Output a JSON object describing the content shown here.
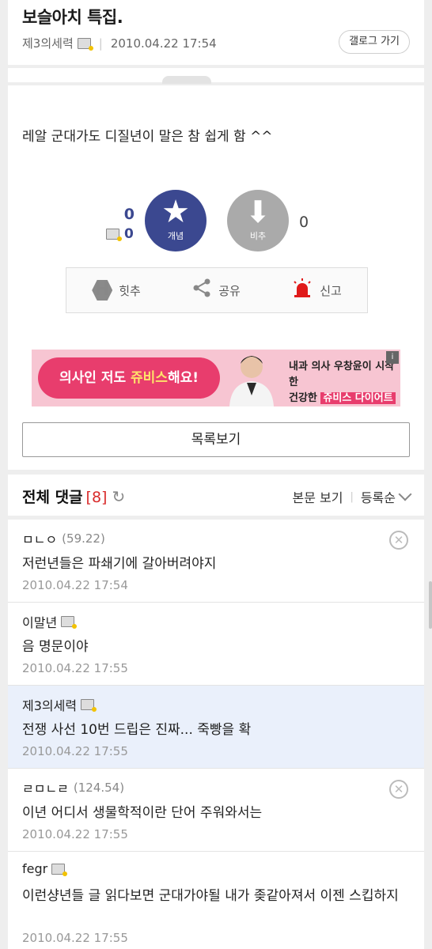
{
  "post": {
    "title": "보슬아치 특집.",
    "author": "제3의세력",
    "date": "2010.04.22 17:54",
    "gallog_button": "갤로그 가기",
    "content": "레알 군대가도 디질년이 말은 참 쉽게 함 ^^"
  },
  "recommend": {
    "up_count": "0",
    "fixed_count": "0",
    "up_label": "개념",
    "down_label": "비추",
    "down_count": "0"
  },
  "actions": {
    "hit_label": "힛추",
    "share_label": "공유",
    "report_label": "신고"
  },
  "banner": {
    "left_prefix": "의사인 저도 ",
    "left_highlight": "쥬비스",
    "left_suffix": "해요!",
    "right_line1": "내과 의사 우창윤이 시작한",
    "right_line2_prefix": "건강한 ",
    "right_line2_highlight": "쥬비스 다이어트",
    "ad_mark": "i"
  },
  "list_button": "목록보기",
  "comments_header": {
    "title": "전체 댓글",
    "count": "[8]",
    "view_body": "본문 보기",
    "sort": "등록순"
  },
  "comments": [
    {
      "name": "ㅁㄴㅇ",
      "ip": "(59.22)",
      "text": "저런년들은 파쇄기에 갈아버려야지",
      "date": "2010.04.22 17:54"
    },
    {
      "name": "이말년",
      "ip": "",
      "text": "음 명문이야",
      "date": "2010.04.22 17:55"
    },
    {
      "name": "제3의세력",
      "ip": "",
      "text": "전쟁 사선 10번 드립은 진짜... 죽빵을 확",
      "date": "2010.04.22 17:55"
    },
    {
      "name": "ㄹㅁㄴㄹ",
      "ip": "(124.54)",
      "text": "이년 어디서 생물학적이란 단어 주워와서는",
      "date": "2010.04.22 17:55"
    },
    {
      "name": "fegr",
      "ip": "",
      "text": "이런샹년들 글 읽다보면 군대가야될 내가 좆같아져서 이젠 스킵하지",
      "date": "2010.04.22 17:55"
    }
  ],
  "colors": {
    "accent": "#3b4890",
    "count_red": "#d92b2b",
    "mine_bg": "#eaf0fb"
  }
}
